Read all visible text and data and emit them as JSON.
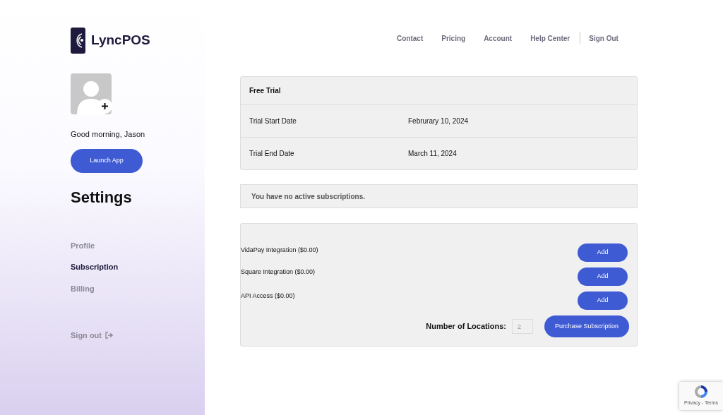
{
  "brand": {
    "name": "LyncPOS"
  },
  "nav": [
    {
      "label": "Contact"
    },
    {
      "label": "Pricing"
    },
    {
      "label": "Account"
    },
    {
      "label": "Help Center"
    },
    {
      "label": "Sign Out"
    }
  ],
  "sidebar": {
    "greeting": "Good morning, Jason",
    "launch_button": "Launch App",
    "heading": "Settings",
    "items": [
      {
        "label": "Profile",
        "selected": false
      },
      {
        "label": "Subscription",
        "selected": true
      },
      {
        "label": "Billing",
        "selected": false
      }
    ],
    "sign_out": "Sign out"
  },
  "trial": {
    "title": "Free Trial",
    "rows": [
      {
        "label": "Trial Start Date",
        "value": "Februrary 10, 2024"
      },
      {
        "label": "Trial End Date",
        "value": "March 11, 2024"
      }
    ]
  },
  "subscriptions_notice": "You have no active subscriptions.",
  "addons": [
    {
      "label": "VidaPay Integration ($0.00)",
      "button": "Add"
    },
    {
      "label": "Square Integration ($0.00)",
      "button": "Add"
    },
    {
      "label": "API Access ($0.00)",
      "button": "Add"
    }
  ],
  "locations": {
    "label": "Number of Locations:",
    "placeholder": "2"
  },
  "purchase_button": "Purchase Subscription",
  "recaptcha": {
    "links": "Privacy - Terms"
  }
}
